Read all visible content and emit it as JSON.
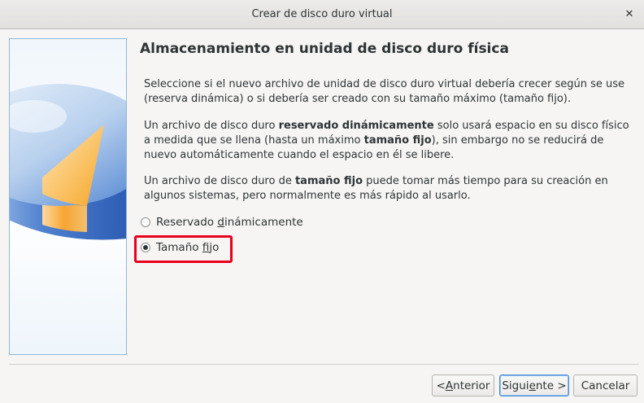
{
  "window": {
    "title": "Crear de disco duro virtual",
    "close_icon": "close-icon"
  },
  "page": {
    "heading": "Almacenamiento en unidad de disco duro física",
    "p1": "Seleccione si el nuevo archivo de unidad de disco duro virtual debería crecer según se use (reserva dinámica) o si debería ser creado con su tamaño máximo (tamaño fijo).",
    "p2": {
      "a": "Un archivo de disco duro ",
      "b": "reservado dinámicamente",
      "c": " solo usará espacio en su disco físico a medida que se llena (hasta un máximo ",
      "d": "tamaño fijo",
      "e": "), sin embargo no se reducirá de nuevo automáticamente cuando el espacio en él se libere."
    },
    "p3": {
      "a": "Un archivo de disco duro de ",
      "b": "tamaño fijo",
      "c": " puede tomar más tiempo para su creación en algunos sistemas, pero normalmente es más rápido al usarlo."
    }
  },
  "options": {
    "dynamic": {
      "pre": "Reservado ",
      "mnemonic": "d",
      "post": "inámicamente",
      "checked": false
    },
    "fixed": {
      "pre": "Tamaño ",
      "mnemonic": "f",
      "post": "ijo",
      "checked": true
    }
  },
  "buttons": {
    "back": {
      "pre": "< ",
      "mnemonic": "A",
      "post": "nterior"
    },
    "next": {
      "pre": "Sigui",
      "mnemonic": "e",
      "post": "nte >"
    },
    "cancel": "Cancelar"
  },
  "colors": {
    "highlight": "#e8001c",
    "disk_blue": "#3a6fc4",
    "disk_orange": "#f5a623"
  }
}
